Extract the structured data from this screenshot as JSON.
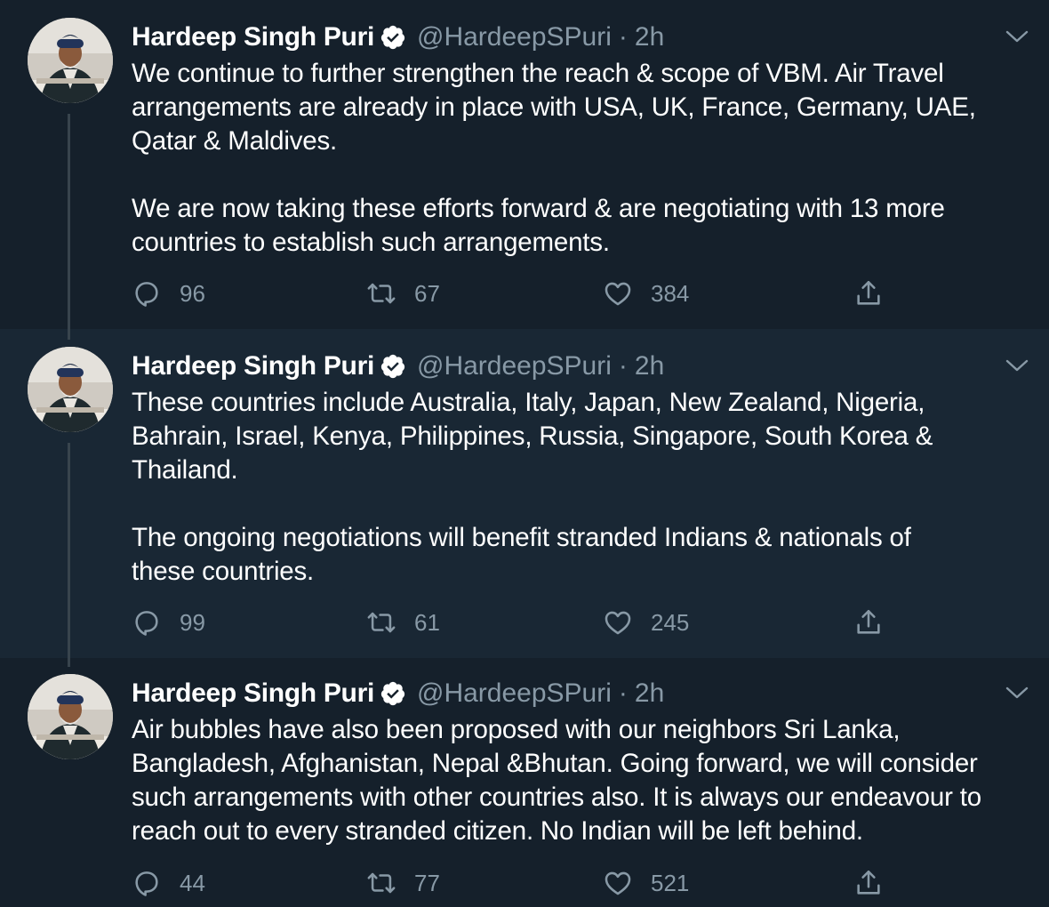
{
  "colors": {
    "background": "#15202b",
    "background_alt": "#192734",
    "text": "#ffffff",
    "secondary_text": "#8899a6",
    "thread_line": "#38444d",
    "verified": "#ffffff"
  },
  "icons": {
    "verified": "verified-badge-icon",
    "menu": "chevron-down-icon",
    "reply": "reply-icon",
    "retweet": "retweet-icon",
    "like": "heart-icon",
    "share": "share-icon"
  },
  "tweets": [
    {
      "author": {
        "name": "Hardeep Singh Puri",
        "handle": "@HardeepSPuri"
      },
      "separator": "·",
      "time": "2h",
      "text": "We continue to further strengthen the reach & scope of VBM. Air Travel\narrangements are already in place with USA, UK, France, Germany, UAE,\nQatar & Maldives.\n\nWe are now taking these efforts forward & are negotiating with 13 more\ncountries to establish such arrangements.",
      "replies": "96",
      "retweets": "67",
      "likes": "384"
    },
    {
      "author": {
        "name": "Hardeep Singh Puri",
        "handle": "@HardeepSPuri"
      },
      "separator": "·",
      "time": "2h",
      "text": "These countries include Australia, Italy, Japan, New Zealand, Nigeria,\nBahrain, Israel, Kenya, Philippines, Russia, Singapore, South Korea &\nThailand.\n\nThe ongoing negotiations will benefit stranded Indians & nationals of\nthese countries.",
      "replies": "99",
      "retweets": "61",
      "likes": "245"
    },
    {
      "author": {
        "name": "Hardeep Singh Puri",
        "handle": "@HardeepSPuri"
      },
      "separator": "·",
      "time": "2h",
      "text": "Air bubbles have also been proposed with our neighbors Sri Lanka,\nBangladesh, Afghanistan, Nepal &Bhutan. Going forward, we will consider\nsuch arrangements with other countries also. It is always our endeavour to\nreach out to every stranded citizen. No Indian will be left behind.",
      "replies": "44",
      "retweets": "77",
      "likes": "521"
    }
  ]
}
